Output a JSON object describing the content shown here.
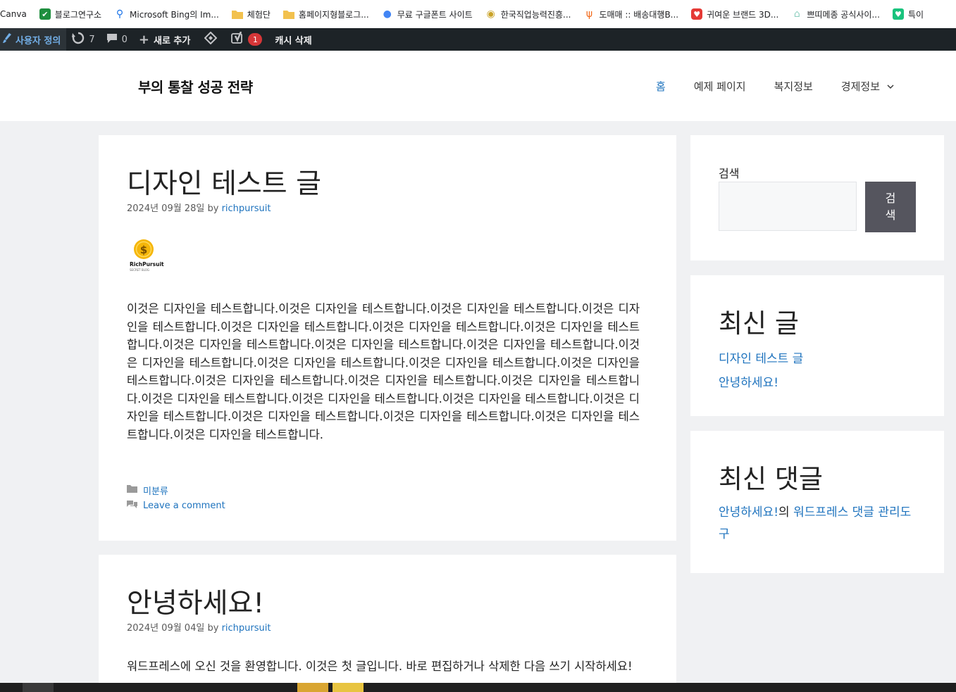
{
  "bookmarks": [
    {
      "label": "Canva",
      "icon": "canva-icon",
      "color": "#00c4cc"
    },
    {
      "label": "블로그연구소",
      "icon": "check-icon",
      "color": "#1e8e3e"
    },
    {
      "label": "Microsoft Bing의 Im...",
      "icon": "search-icon",
      "color": "#1a73e8"
    },
    {
      "label": "체험단",
      "icon": "folder-icon",
      "color": "#f2c14e"
    },
    {
      "label": "홈페이지형블로그...",
      "icon": "folder-icon",
      "color": "#f2c14e"
    },
    {
      "label": "무료 구글폰트 사이트",
      "icon": "google-icon",
      "color": "#4285f4"
    },
    {
      "label": "한국직업능력진흥...",
      "icon": "seal-icon",
      "color": "#c9a227"
    },
    {
      "label": "도매매 :: 배송대행B...",
      "icon": "fork-icon",
      "color": "#f26b1d"
    },
    {
      "label": "귀여운 브랜드 3D...",
      "icon": "heart-icon",
      "color": "#e53935"
    },
    {
      "label": "쁘띠메종 공식사이...",
      "icon": "house-icon",
      "color": "#8fd0c0"
    },
    {
      "label": "특이",
      "icon": "heart-icon",
      "color": "#19c37d"
    }
  ],
  "adminbar": {
    "customize": "사용자 정의",
    "updates": "7",
    "comments": "0",
    "new": "새로 추가",
    "yoast_badge": "1",
    "cache": "캐시 삭제"
  },
  "site": {
    "title": "부의 통찰 성공 전략",
    "nav": [
      "홈",
      "예제 페이지",
      "복지정보",
      "경제정보"
    ]
  },
  "post1": {
    "title": "디자인 테스트 글",
    "date": "2024년 09월 28일",
    "by": "by",
    "author": "richpursuit",
    "logo_text": "RichPursuit",
    "logo_sub": "SECRET BLOG",
    "body": "이것은 디자인을 테스트합니다.이것은 디자인을 테스트합니다.이것은 디자인을 테스트합니다.이것은 디자인을 테스트합니다.이것은 디자인을 테스트합니다.이것은 디자인을 테스트합니다.이것은 디자인을 테스트합니다.이것은 디자인을 테스트합니다.이것은 디자인을 테스트합니다.이것은 디자인을 테스트합니다.이것은 디자인을 테스트합니다.이것은 디자인을 테스트합니다.이것은 디자인을 테스트합니다.이것은 디자인을 테스트합니다.이것은 디자인을 테스트합니다.이것은 디자인을 테스트합니다.이것은 디자인을 테스트합니다.이것은 디자인을 테스트합니다.이것은 디자인을 테스트합니다.이것은 디자인을 테스트합니다.이것은 디자인을 테스트합니다.이것은 디자인을 테스트합니다.이것은 디자인을 테스트합니다.이것은 디자인을 테스트합니다.이것은 디자인을 테스트합니다.",
    "category": "미분류",
    "comment_link": "Leave a comment"
  },
  "post2": {
    "title": "안녕하세요!",
    "date": "2024년 09월 04일",
    "by": "by",
    "author": "richpursuit",
    "body": "워드프레스에 오신 것을 환영합니다. 이것은 첫 글입니다. 바로 편집하거나 삭제한 다음 쓰기 시작하세요!"
  },
  "sidebar": {
    "search_label": "검색",
    "search_button": "검색",
    "recent_posts_title": "최신 글",
    "recent_posts": [
      "디자인 테스트 글",
      "안녕하세요!"
    ],
    "recent_comments_title": "최신 댓글",
    "comment_post": "안녕하세요!",
    "comment_sep": "의",
    "comment_author": "워드프레스 댓글 관리도구"
  }
}
